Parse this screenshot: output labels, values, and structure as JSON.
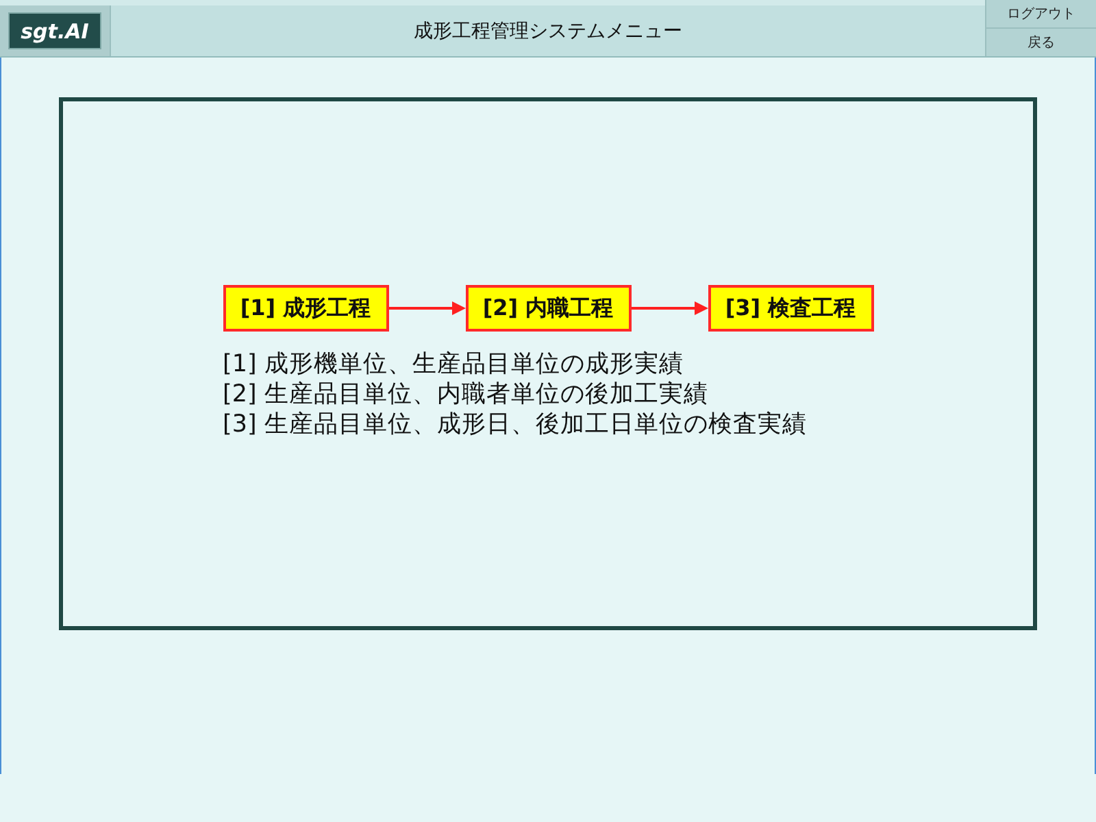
{
  "header": {
    "logo": "sgt.AI",
    "title": "成形工程管理システムメニュー",
    "buttons": [
      "ログアウト",
      "戻る"
    ]
  },
  "flow": {
    "steps": [
      {
        "label": "[1] 成形工程"
      },
      {
        "label": "[2] 内職工程"
      },
      {
        "label": "[3] 検査工程"
      }
    ],
    "descriptions": [
      "[1] 成形機単位、生産品目単位の成形実績",
      "[2] 生産品目単位、内職者単位の後加工実績",
      "[3] 生産品目単位、成形日、後加工日単位の検査実績"
    ]
  }
}
